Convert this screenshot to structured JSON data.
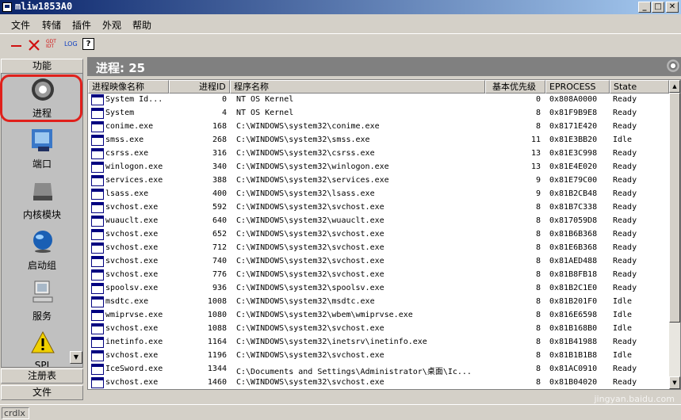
{
  "window": {
    "title": "mliw1853A0",
    "minimize": "_",
    "maximize": "□",
    "close": "✕"
  },
  "menu": [
    "文件",
    "转储",
    "插件",
    "外观",
    "帮助"
  ],
  "toolbar": {
    "gdt_label": "GDT IDT",
    "log_label": "LOG",
    "help_label": "?"
  },
  "nav": {
    "header": "功能",
    "items": [
      {
        "label": "进程",
        "icon": "gear-icon"
      },
      {
        "label": "端口",
        "icon": "network-icon"
      },
      {
        "label": "内核模块",
        "icon": "drive-icon"
      },
      {
        "label": "启动组",
        "icon": "globe-icon"
      },
      {
        "label": "服务",
        "icon": "computer-icon"
      },
      {
        "label": "SPI",
        "icon": "warning-icon"
      }
    ],
    "footer": [
      "注册表",
      "文件"
    ]
  },
  "main": {
    "process_count_label": "进程: 25"
  },
  "columns": [
    "进程映像名称",
    "进程ID",
    "程序名称",
    "基本优先级",
    "EPROCESS",
    "State"
  ],
  "rows": [
    {
      "name": "System Id...",
      "pid": "0",
      "path": "NT OS Kernel",
      "prio": "0",
      "eproc": "0x808A0000",
      "state": "Ready"
    },
    {
      "name": "System",
      "pid": "4",
      "path": "NT OS Kernel",
      "prio": "8",
      "eproc": "0x81F9B9E8",
      "state": "Ready"
    },
    {
      "name": "conime.exe",
      "pid": "168",
      "path": "C:\\WINDOWS\\system32\\conime.exe",
      "prio": "8",
      "eproc": "0x8171E420",
      "state": "Ready"
    },
    {
      "name": "smss.exe",
      "pid": "268",
      "path": "C:\\WINDOWS\\system32\\smss.exe",
      "prio": "11",
      "eproc": "0x81E3BB20",
      "state": "Idle"
    },
    {
      "name": "csrss.exe",
      "pid": "316",
      "path": "C:\\WINDOWS\\system32\\csrss.exe",
      "prio": "13",
      "eproc": "0x81E3C998",
      "state": "Ready"
    },
    {
      "name": "winlogon.exe",
      "pid": "340",
      "path": "C:\\WINDOWS\\system32\\winlogon.exe",
      "prio": "13",
      "eproc": "0x81E4E020",
      "state": "Ready"
    },
    {
      "name": "services.exe",
      "pid": "388",
      "path": "C:\\WINDOWS\\system32\\services.exe",
      "prio": "9",
      "eproc": "0x81E79C00",
      "state": "Ready"
    },
    {
      "name": "lsass.exe",
      "pid": "400",
      "path": "C:\\WINDOWS\\system32\\lsass.exe",
      "prio": "9",
      "eproc": "0x81B2CB48",
      "state": "Ready"
    },
    {
      "name": "svchost.exe",
      "pid": "592",
      "path": "C:\\WINDOWS\\system32\\svchost.exe",
      "prio": "8",
      "eproc": "0x81B7C338",
      "state": "Ready"
    },
    {
      "name": "wuauclt.exe",
      "pid": "640",
      "path": "C:\\WINDOWS\\system32\\wuauclt.exe",
      "prio": "8",
      "eproc": "0x817059D8",
      "state": "Ready"
    },
    {
      "name": "svchost.exe",
      "pid": "652",
      "path": "C:\\WINDOWS\\system32\\svchost.exe",
      "prio": "8",
      "eproc": "0x81B6B368",
      "state": "Ready"
    },
    {
      "name": "svchost.exe",
      "pid": "712",
      "path": "C:\\WINDOWS\\system32\\svchost.exe",
      "prio": "8",
      "eproc": "0x81E6B368",
      "state": "Ready"
    },
    {
      "name": "svchost.exe",
      "pid": "740",
      "path": "C:\\WINDOWS\\system32\\svchost.exe",
      "prio": "8",
      "eproc": "0x81AED488",
      "state": "Ready"
    },
    {
      "name": "svchost.exe",
      "pid": "776",
      "path": "C:\\WINDOWS\\system32\\svchost.exe",
      "prio": "8",
      "eproc": "0x81B8FB18",
      "state": "Ready"
    },
    {
      "name": "spoolsv.exe",
      "pid": "936",
      "path": "C:\\WINDOWS\\system32\\spoolsv.exe",
      "prio": "8",
      "eproc": "0x81B2C1E0",
      "state": "Ready"
    },
    {
      "name": "msdtc.exe",
      "pid": "1008",
      "path": "C:\\WINDOWS\\system32\\msdtc.exe",
      "prio": "8",
      "eproc": "0x81B201F0",
      "state": "Idle"
    },
    {
      "name": "wmiprvse.exe",
      "pid": "1080",
      "path": "C:\\WINDOWS\\system32\\wbem\\wmiprvse.exe",
      "prio": "8",
      "eproc": "0x816E6598",
      "state": "Idle"
    },
    {
      "name": "svchost.exe",
      "pid": "1088",
      "path": "C:\\WINDOWS\\system32\\svchost.exe",
      "prio": "8",
      "eproc": "0x81B168B0",
      "state": "Idle"
    },
    {
      "name": "inetinfo.exe",
      "pid": "1164",
      "path": "C:\\WINDOWS\\system32\\inetsrv\\inetinfo.exe",
      "prio": "8",
      "eproc": "0x81B41988",
      "state": "Ready"
    },
    {
      "name": "svchost.exe",
      "pid": "1196",
      "path": "C:\\WINDOWS\\system32\\svchost.exe",
      "prio": "8",
      "eproc": "0x81B1B1B8",
      "state": "Idle"
    },
    {
      "name": "IceSword.exe",
      "pid": "1344",
      "path": "C:\\Documents and Settings\\Administrator\\桌面\\Ic...",
      "prio": "8",
      "eproc": "0x81AC0910",
      "state": "Ready"
    },
    {
      "name": "svchost.exe",
      "pid": "1460",
      "path": "C:\\WINDOWS\\system32\\svchost.exe",
      "prio": "8",
      "eproc": "0x81B04020",
      "state": "Ready"
    }
  ],
  "status": {
    "panel": "crdlx"
  },
  "watermark": "jingyan.baidu.com"
}
